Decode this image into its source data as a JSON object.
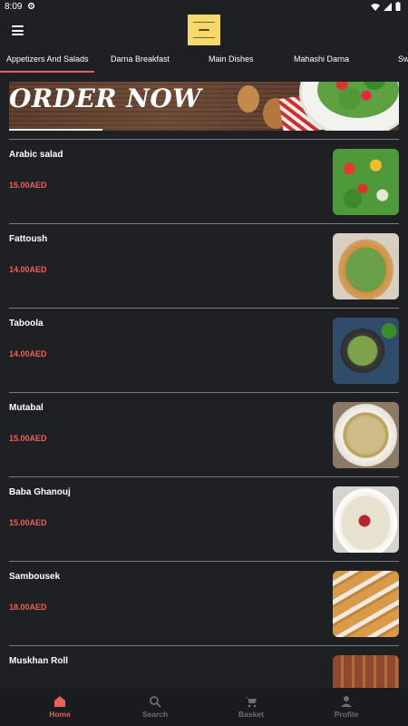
{
  "status_bar": {
    "time": "8:09"
  },
  "tabs": [
    {
      "label": "Appetizers And Salads"
    },
    {
      "label": "Darna Breakfast"
    },
    {
      "label": "Main Dishes"
    },
    {
      "label": "Mahashi Darna"
    },
    {
      "label": "Sw"
    }
  ],
  "banner": {
    "text": "ORDER NOW",
    "carousel_progress": 0.24
  },
  "items": [
    {
      "name": "Arabic salad",
      "price": "15.00AED"
    },
    {
      "name": "Fattoush",
      "price": "14.00AED"
    },
    {
      "name": "Taboola",
      "price": "14.00AED"
    },
    {
      "name": "Mutabal",
      "price": "15.00AED"
    },
    {
      "name": "Baba Ghanouj",
      "price": "15.00AED"
    },
    {
      "name": "Sambousek",
      "price": "18.00AED"
    },
    {
      "name": "Muskhan Roll",
      "price": ""
    }
  ],
  "bottom_nav": [
    {
      "label": "Home",
      "icon": "home-icon"
    },
    {
      "label": "Search",
      "icon": "search-icon"
    },
    {
      "label": "Basket",
      "icon": "basket-icon"
    },
    {
      "label": "Profile",
      "icon": "profile-icon"
    }
  ],
  "colors": {
    "accent": "#e8615a",
    "background": "#1f2023",
    "logo": "#f5d96b",
    "inactive": "#6f6f73"
  }
}
